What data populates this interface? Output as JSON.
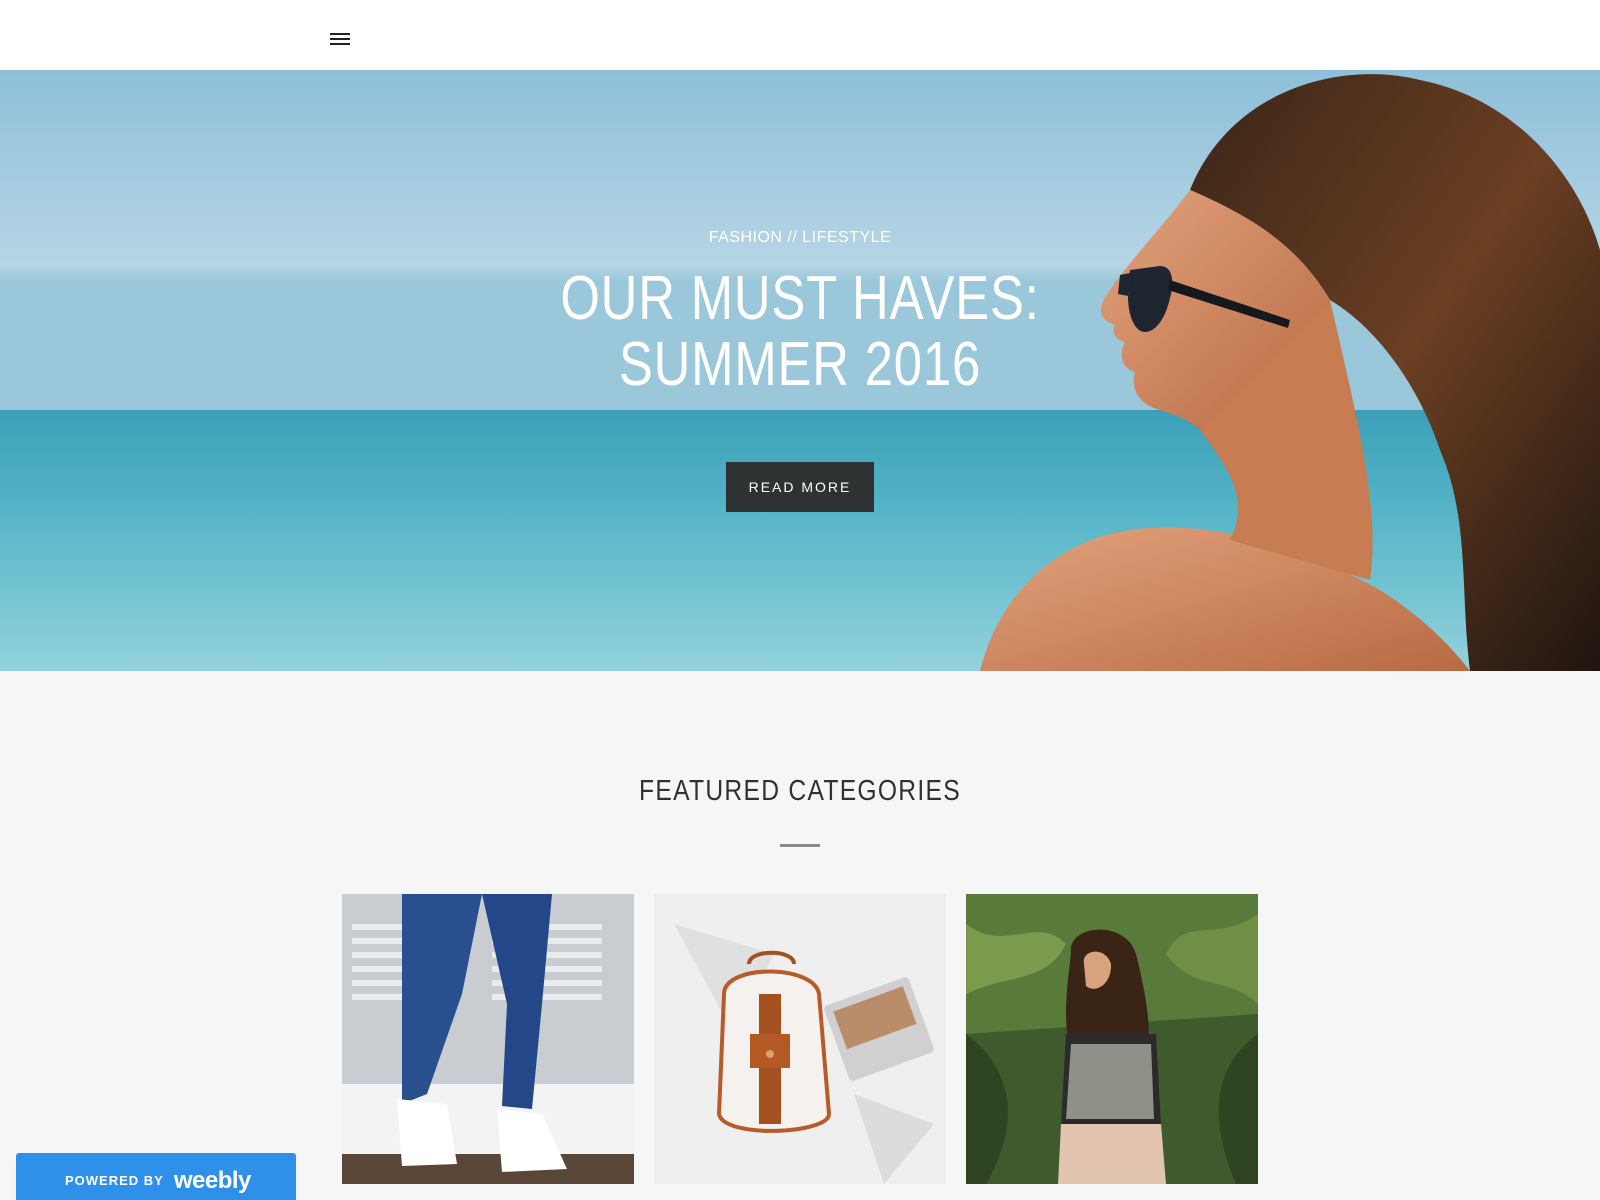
{
  "header": {
    "menu_icon": "hamburger-menu-icon"
  },
  "hero": {
    "subtitle": "FASHION // LIFESTYLE",
    "title_line1": "OUR MUST HAVES:",
    "title_line2": "SUMMER 2016",
    "button_label": "READ MORE"
  },
  "featured": {
    "title": "FEATURED CATEGORIES",
    "cards": [
      {
        "image": "jeans-and-sneakers-photo"
      },
      {
        "image": "backpack-and-magazine-photo"
      },
      {
        "image": "woman-in-jungle-photo"
      }
    ]
  },
  "badge": {
    "powered_label": "POWERED BY",
    "brand": "weebly"
  },
  "colors": {
    "header_bg": "#ffffff",
    "page_bg": "#f6f6f6",
    "button_bg": "#2f3233",
    "badge_bg": "#2e90e8",
    "text_dark": "#2f3233"
  }
}
